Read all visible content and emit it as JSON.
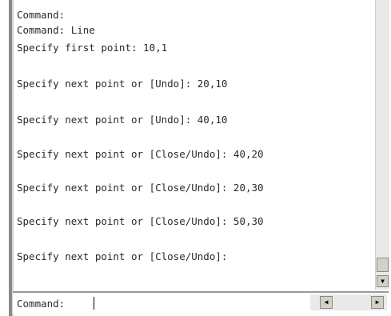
{
  "history": [
    "Command:",
    "Command: Line",
    "Specify first point: 10,1",
    "Specify next point or [Undo]: 20,10",
    "Specify next point or [Undo]: 40,10",
    "Specify next point or [Close/Undo]: 40,20",
    "Specify next point or [Close/Undo]: 20,30",
    "Specify next point or [Close/Undo]: 50,30",
    "Specify next point or [Close/Undo]:"
  ],
  "command_bar": {
    "prompt": "Command:",
    "input_value": ""
  },
  "icons": {
    "scroll_down": "▼",
    "scroll_left": "◀",
    "scroll_right": "▶"
  }
}
